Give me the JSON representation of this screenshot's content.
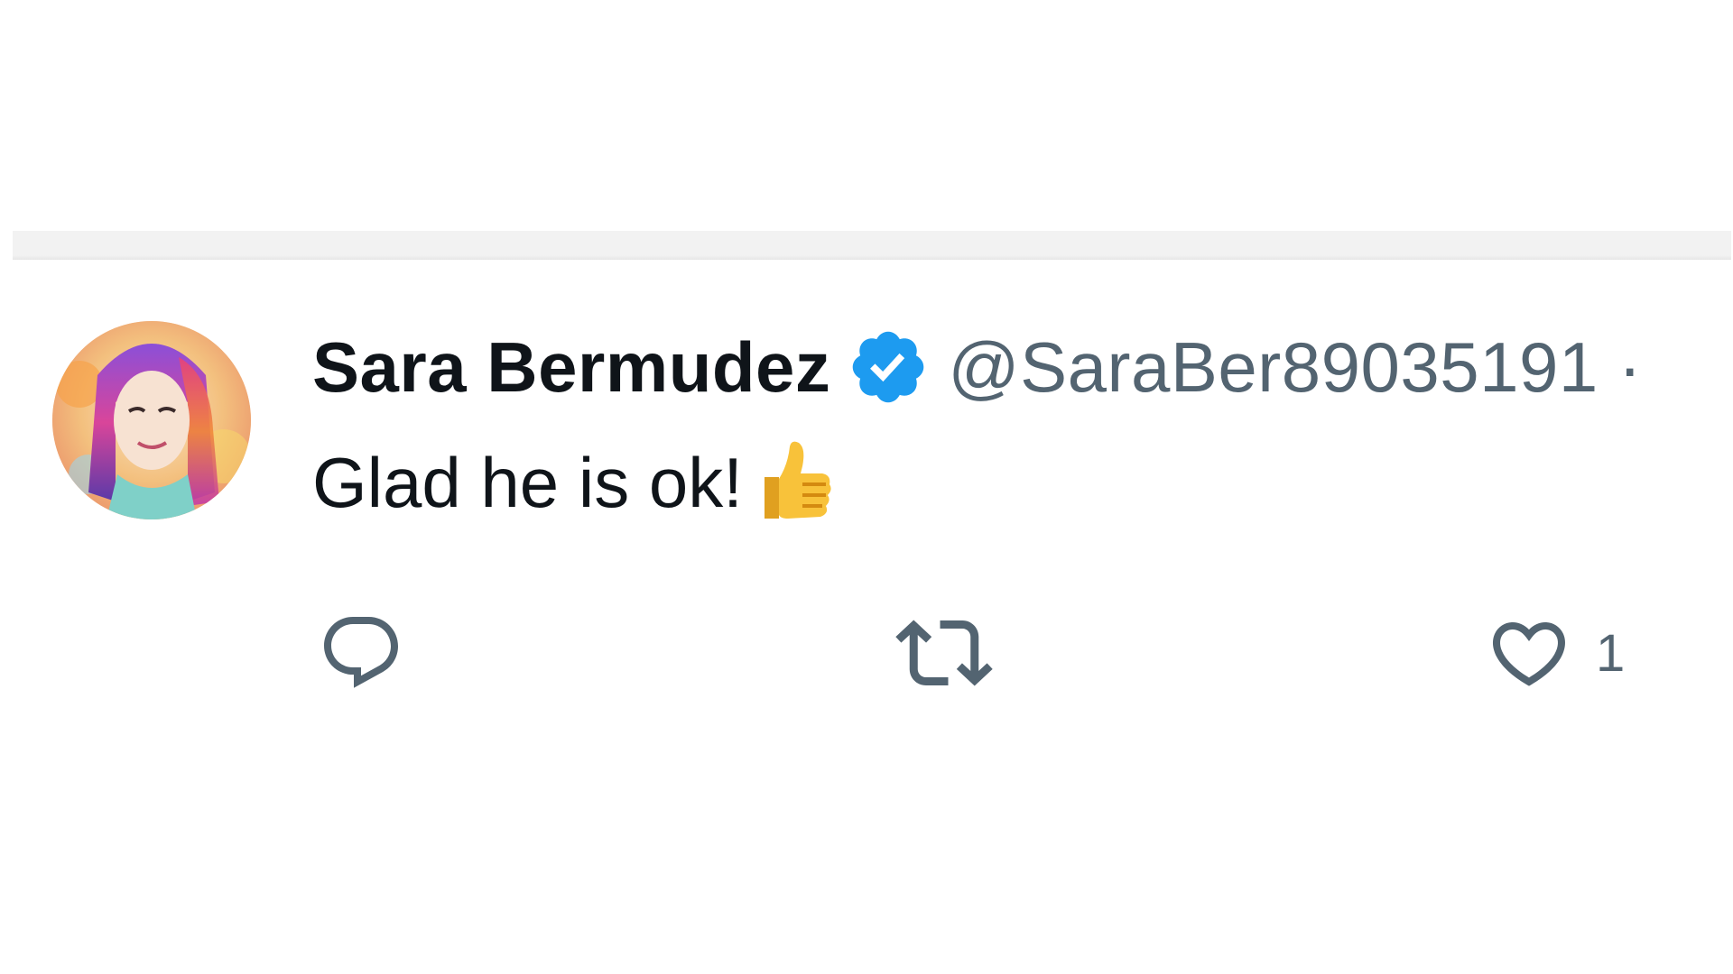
{
  "tweet": {
    "display_name": "Sara Bermudez",
    "handle": "@SaraBer89035191",
    "separator": "·",
    "text": "Glad he is ok!",
    "emoji_icon": "thumbs-up-icon",
    "verified_icon": "verified-badge-icon",
    "avatar": "profile-avatar"
  },
  "actions": {
    "reply_icon": "reply-icon",
    "repost_icon": "repost-icon",
    "like_icon": "heart-icon",
    "like_count": "1"
  },
  "colors": {
    "name": "#0f1419",
    "secondary": "#536471",
    "verified": "#1d9bf0",
    "divider": "#f2f2f2"
  }
}
